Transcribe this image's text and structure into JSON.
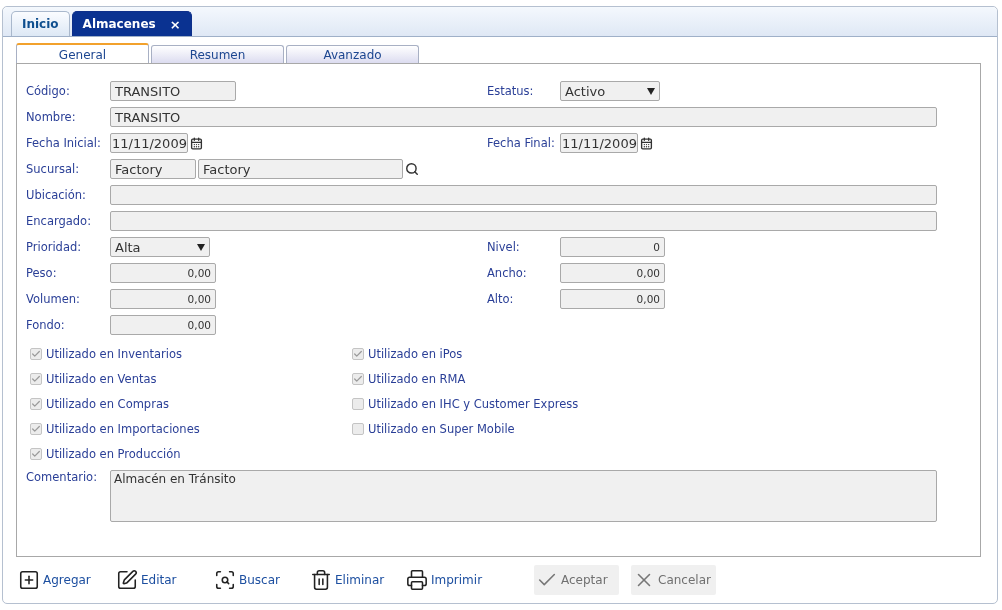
{
  "tabs": [
    {
      "label": "Inicio",
      "selected": false
    },
    {
      "label": "Almacenes",
      "selected": true,
      "close": "×"
    }
  ],
  "subtabs": [
    {
      "label": "General",
      "selected": true
    },
    {
      "label": "Resumen",
      "selected": false
    },
    {
      "label": "Avanzado",
      "selected": false
    }
  ],
  "rows": [
    {
      "left": {
        "label": "Código:",
        "kind": "short",
        "value": "TRANSITO"
      },
      "right": {
        "label": "Estatus:",
        "kind": "select",
        "value": "Activo"
      }
    },
    {
      "left": {
        "label": "Nombre:",
        "kind": "wide",
        "value": "TRANSITO"
      }
    },
    {
      "left": {
        "label": "Fecha Inicial:",
        "kind": "date",
        "value": "11/11/2009"
      },
      "right": {
        "label": "Fecha Final:",
        "kind": "date",
        "value": "11/11/2009"
      }
    },
    {
      "left": {
        "label": "Sucursal:",
        "kind": "lookup",
        "value": "Factory",
        "value2": "Factory"
      }
    },
    {
      "left": {
        "label": "Ubicación:",
        "kind": "wide"
      }
    },
    {
      "left": {
        "label": "Encargado:",
        "kind": "wide"
      }
    },
    {
      "left": {
        "label": "Prioridad:",
        "kind": "select",
        "value": "Alta"
      },
      "right": {
        "label": "Nivel:",
        "kind": "number",
        "value": "0"
      }
    },
    {
      "left": {
        "label": "Peso:",
        "kind": "number",
        "value": "0,00"
      },
      "right": {
        "label": "Ancho:",
        "kind": "number",
        "value": "0,00"
      }
    },
    {
      "left": {
        "label": "Volumen:",
        "kind": "number",
        "value": "0,00"
      },
      "right": {
        "label": "Alto:",
        "kind": "number",
        "value": "0,00"
      }
    },
    {
      "left": {
        "label": "Fondo:",
        "kind": "number",
        "value": "0,00"
      }
    }
  ],
  "checks_left": [
    {
      "label": "Utilizado en Inventarios",
      "checked": true
    },
    {
      "label": "Utilizado en Ventas",
      "checked": true
    },
    {
      "label": "Utilizado en Compras",
      "checked": true
    },
    {
      "label": "Utilizado en Importaciones",
      "checked": true
    },
    {
      "label": "Utilizado en Producción",
      "checked": true
    }
  ],
  "checks_right": [
    {
      "label": "Utilizado en iPos",
      "checked": true
    },
    {
      "label": "Utilizado en RMA",
      "checked": true
    },
    {
      "label": "Utilizado en IHC y Customer Express",
      "checked": false
    },
    {
      "label": "Utilizado en Super Mobile",
      "checked": false
    }
  ],
  "comment": {
    "label": "Comentario:",
    "value": "Almacén en Tránsito"
  },
  "toolbar": [
    {
      "kind": "add",
      "label": "Agregar",
      "disabled": false
    },
    {
      "kind": "edit",
      "label": "Editar",
      "disabled": false
    },
    {
      "kind": "search",
      "label": "Buscar",
      "disabled": false
    },
    {
      "kind": "delete",
      "label": "Eliminar",
      "disabled": false
    },
    {
      "kind": "print",
      "label": "Imprimir",
      "disabled": false
    },
    {
      "kind": "accept",
      "label": "Aceptar",
      "disabled": true
    },
    {
      "kind": "cancel",
      "label": "Cancelar",
      "disabled": true
    }
  ]
}
